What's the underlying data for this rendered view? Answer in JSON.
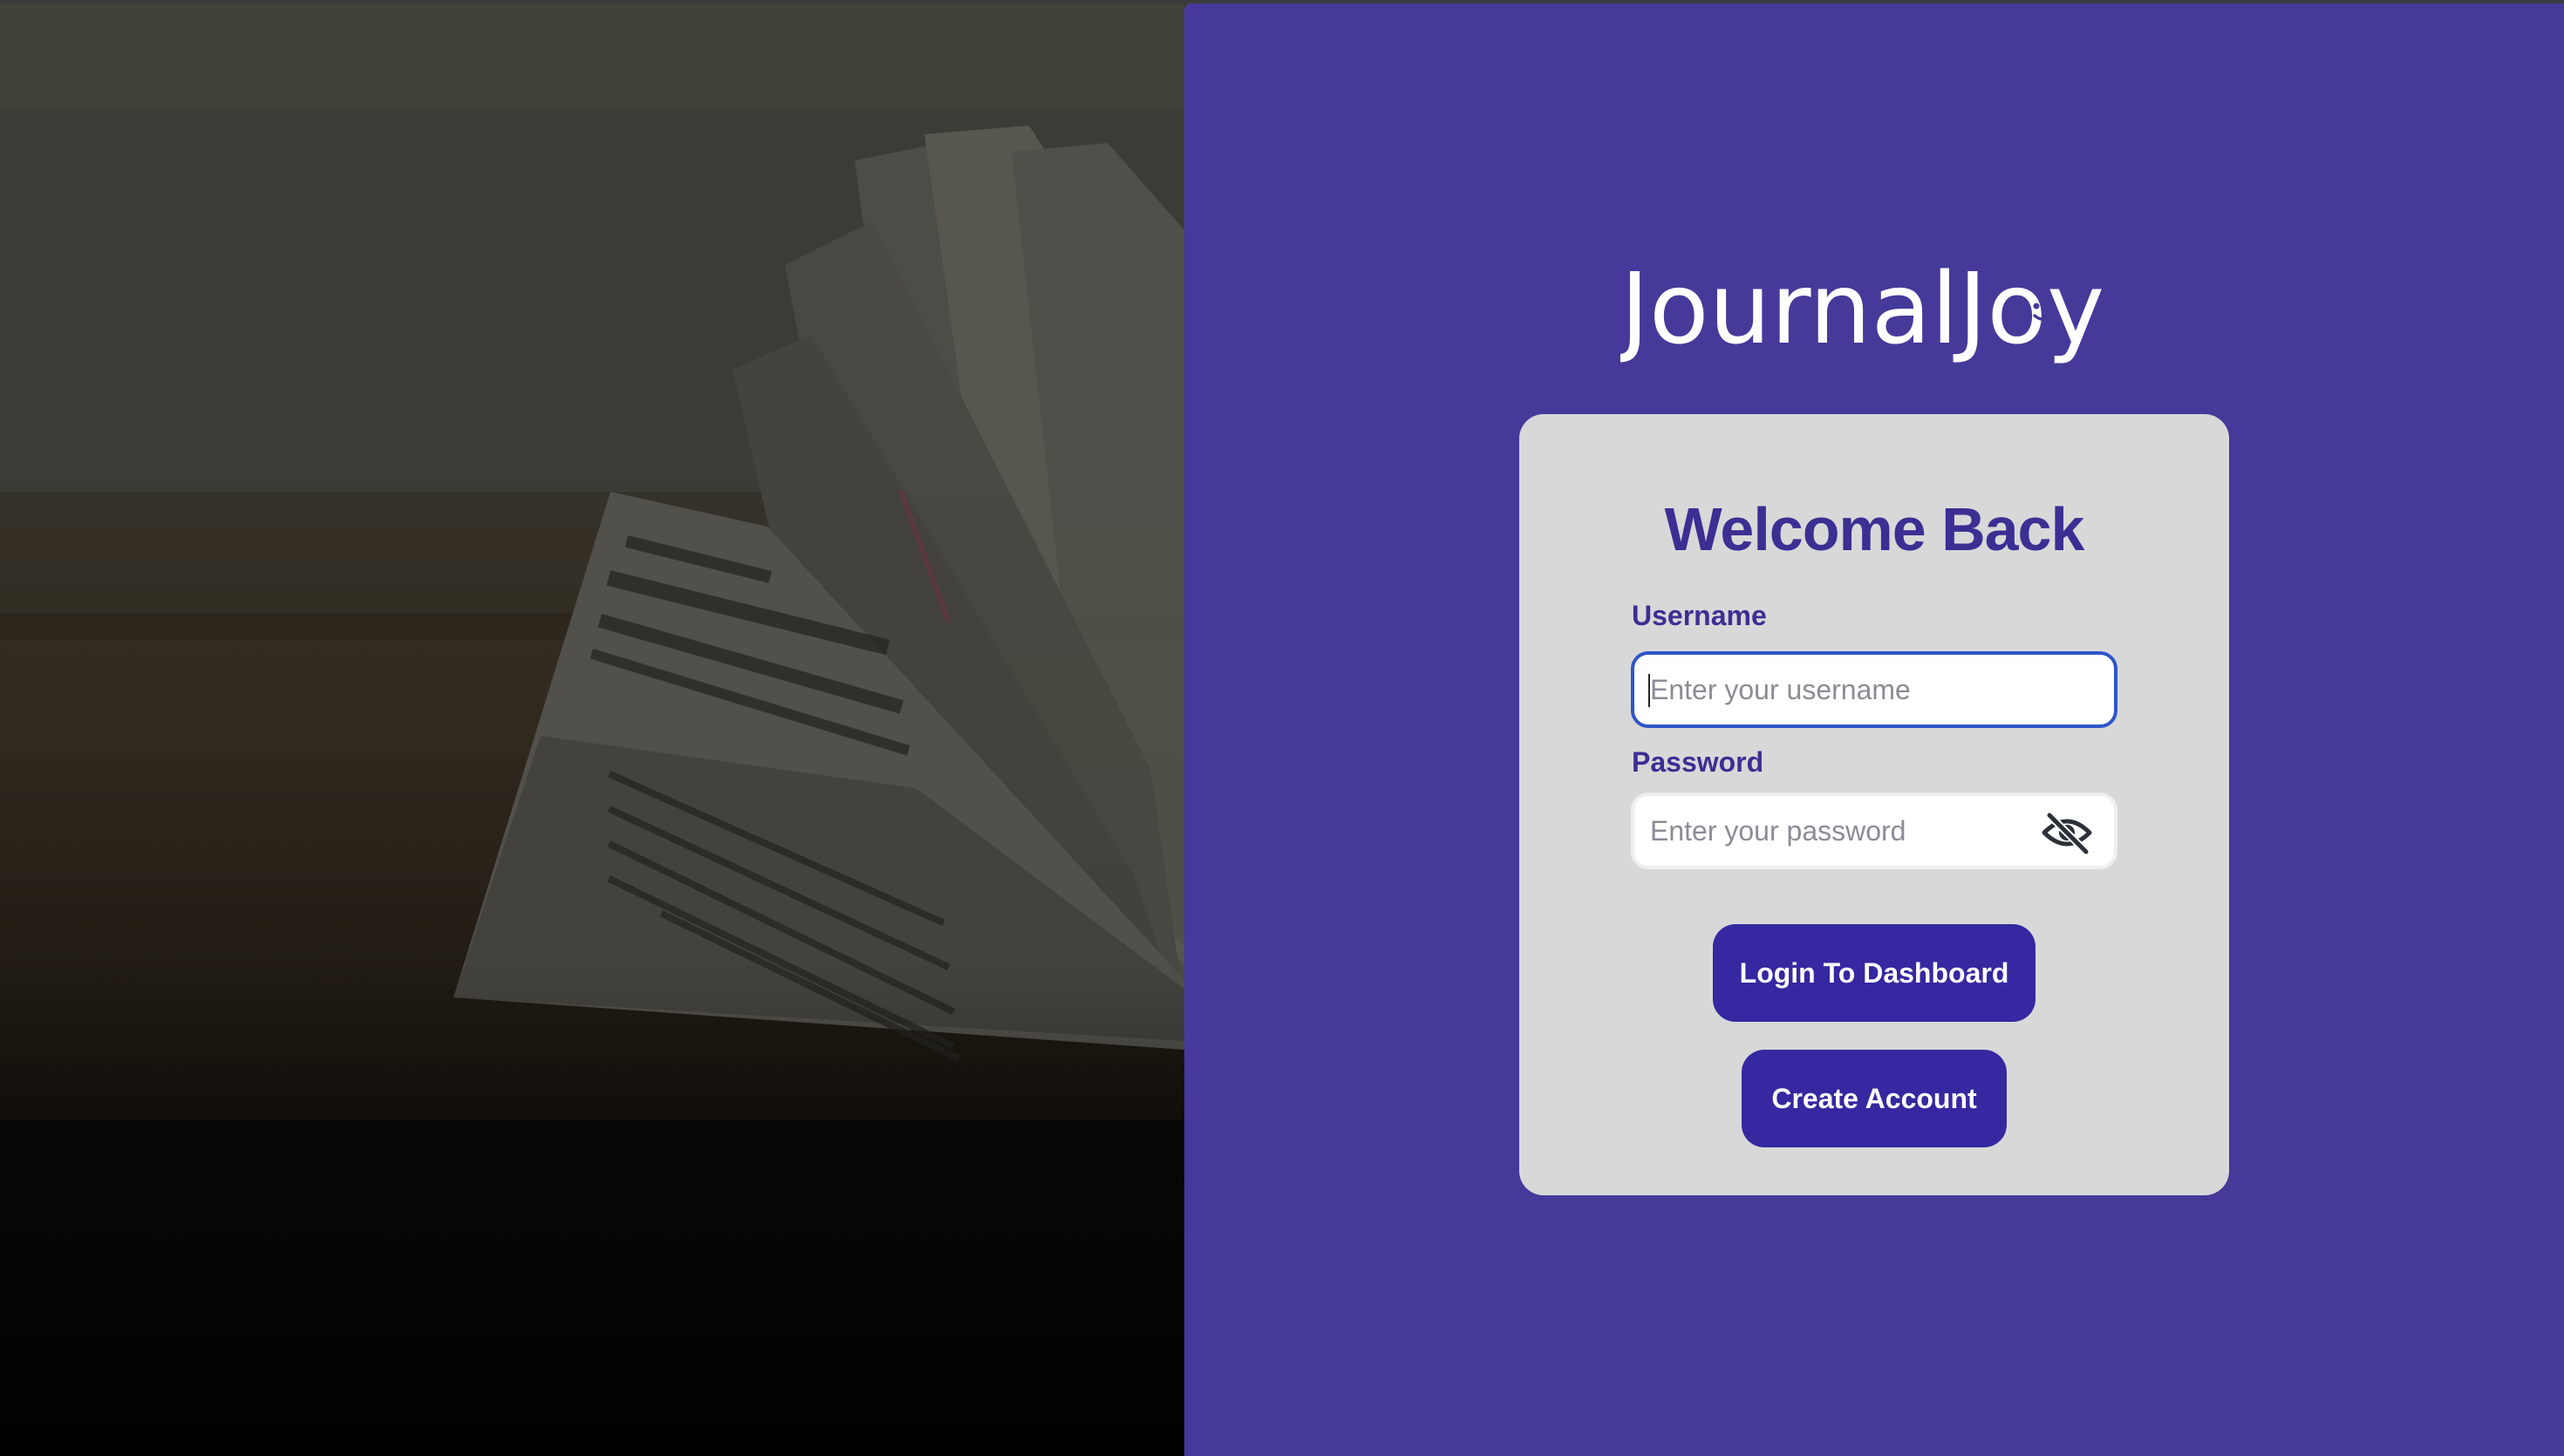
{
  "brand": {
    "logo_text": "JournalJoy"
  },
  "login": {
    "title": "Welcome Back",
    "username_label": "Username",
    "username_placeholder": "Enter your username",
    "username_value": "",
    "password_label": "Password",
    "password_placeholder": "Enter your password",
    "password_value": "",
    "password_toggle_icon": "eye-slash-icon",
    "login_button": "Login To Dashboard",
    "create_button": "Create Account"
  },
  "colors": {
    "brand_panel": "#45399a",
    "card": "#d8d8d9",
    "accent_text": "#3b2f93",
    "button": "#3528a0",
    "focus_border": "#2f55c8"
  }
}
